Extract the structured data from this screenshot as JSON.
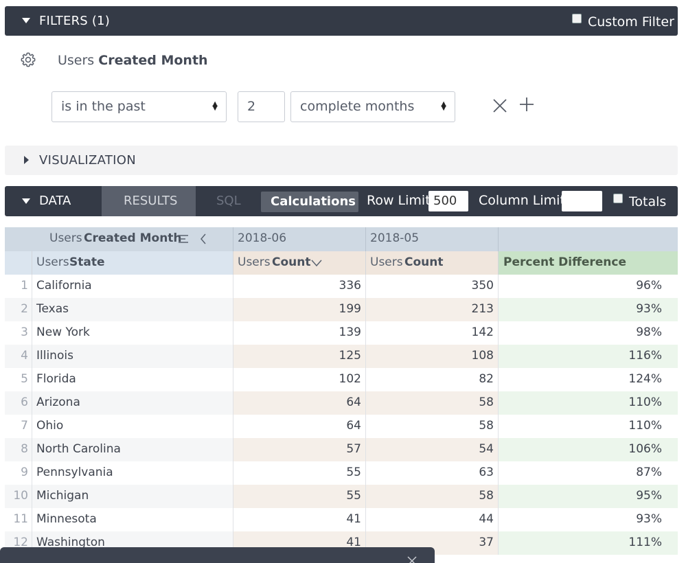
{
  "filters": {
    "title": "FILTERS (1)",
    "custom_filter_label": "Custom Filter",
    "field_view": "Users",
    "field_name": "Created Month",
    "operator": "is in the past",
    "value": "2",
    "unit": "complete months"
  },
  "visualization": {
    "title": "VISUALIZATION"
  },
  "data_bar": {
    "title": "DATA",
    "results_tab": "RESULTS",
    "sql_tab": "SQL",
    "calculations_button": "Calculations",
    "row_limit_label": "Row Limit",
    "row_limit_value": "500",
    "column_limit_label": "Column Limit",
    "column_limit_value": "",
    "totals_label": "Totals"
  },
  "table": {
    "pivot_label_view": "Users",
    "pivot_label_field": "Created Month",
    "pivots": [
      "2018-06",
      "2018-05"
    ],
    "dimension_view": "Users",
    "dimension_field": "State",
    "measure_view": "Users",
    "measure_field": "Count",
    "calc_header": "Percent Difference",
    "rows": [
      {
        "n": "1",
        "state": "California",
        "c1": "336",
        "c2": "350",
        "pct": "96%"
      },
      {
        "n": "2",
        "state": "Texas",
        "c1": "199",
        "c2": "213",
        "pct": "93%"
      },
      {
        "n": "3",
        "state": "New York",
        "c1": "139",
        "c2": "142",
        "pct": "98%"
      },
      {
        "n": "4",
        "state": "Illinois",
        "c1": "125",
        "c2": "108",
        "pct": "116%"
      },
      {
        "n": "5",
        "state": "Florida",
        "c1": "102",
        "c2": "82",
        "pct": "124%"
      },
      {
        "n": "6",
        "state": "Arizona",
        "c1": "64",
        "c2": "58",
        "pct": "110%"
      },
      {
        "n": "7",
        "state": "Ohio",
        "c1": "64",
        "c2": "58",
        "pct": "110%"
      },
      {
        "n": "8",
        "state": "North Carolina",
        "c1": "57",
        "c2": "54",
        "pct": "106%"
      },
      {
        "n": "9",
        "state": "Pennsylvania",
        "c1": "55",
        "c2": "63",
        "pct": "87%"
      },
      {
        "n": "10",
        "state": "Michigan",
        "c1": "55",
        "c2": "58",
        "pct": "95%"
      },
      {
        "n": "11",
        "state": "Minnesota",
        "c1": "41",
        "c2": "44",
        "pct": "93%"
      },
      {
        "n": "12",
        "state": "Washington",
        "c1": "41",
        "c2": "37",
        "pct": "111%"
      }
    ]
  },
  "colors": {
    "bar_dark": "#343a46",
    "pivot_header": "#cfd9e3",
    "dimension_header": "#dbe5ef",
    "measure_header": "#f0e6dd",
    "calc_header": "#c9e3c8",
    "measure_stripe": "#f5efe9",
    "calc_stripe": "#ecf6ec"
  }
}
